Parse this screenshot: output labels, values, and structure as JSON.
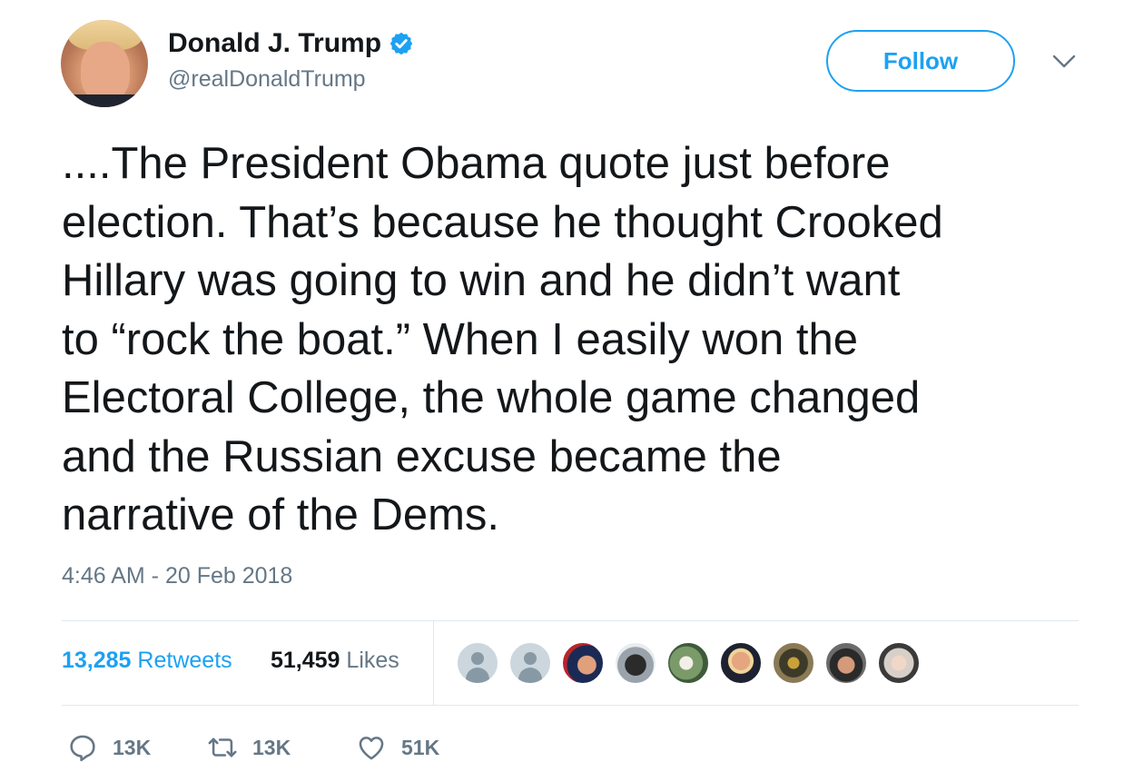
{
  "author": {
    "display_name": "Donald J. Trump",
    "handle": "@realDonaldTrump",
    "verified": true
  },
  "header": {
    "follow_label": "Follow"
  },
  "tweet": {
    "text": "....The President Obama quote just before\nelection. That’s because he thought Crooked\nHillary was going to win and he didn’t want\nto “rock the boat.” When I easily won the\nElectoral College, the whole game changed\nand the Russian excuse became the\nnarrative of the Dems.",
    "timestamp": "4:46 AM - 20 Feb 2018"
  },
  "stats": {
    "retweets_count": "13,285",
    "retweets_label": "Retweets",
    "likes_count": "51,459",
    "likes_label": "Likes"
  },
  "actions": {
    "reply_count": "13K",
    "retweet_count": "13K",
    "like_count": "51K"
  },
  "colors": {
    "accent": "#1da1f2",
    "secondary_text": "#657786",
    "primary_text": "#14171a",
    "divider": "#e1e8ed"
  }
}
